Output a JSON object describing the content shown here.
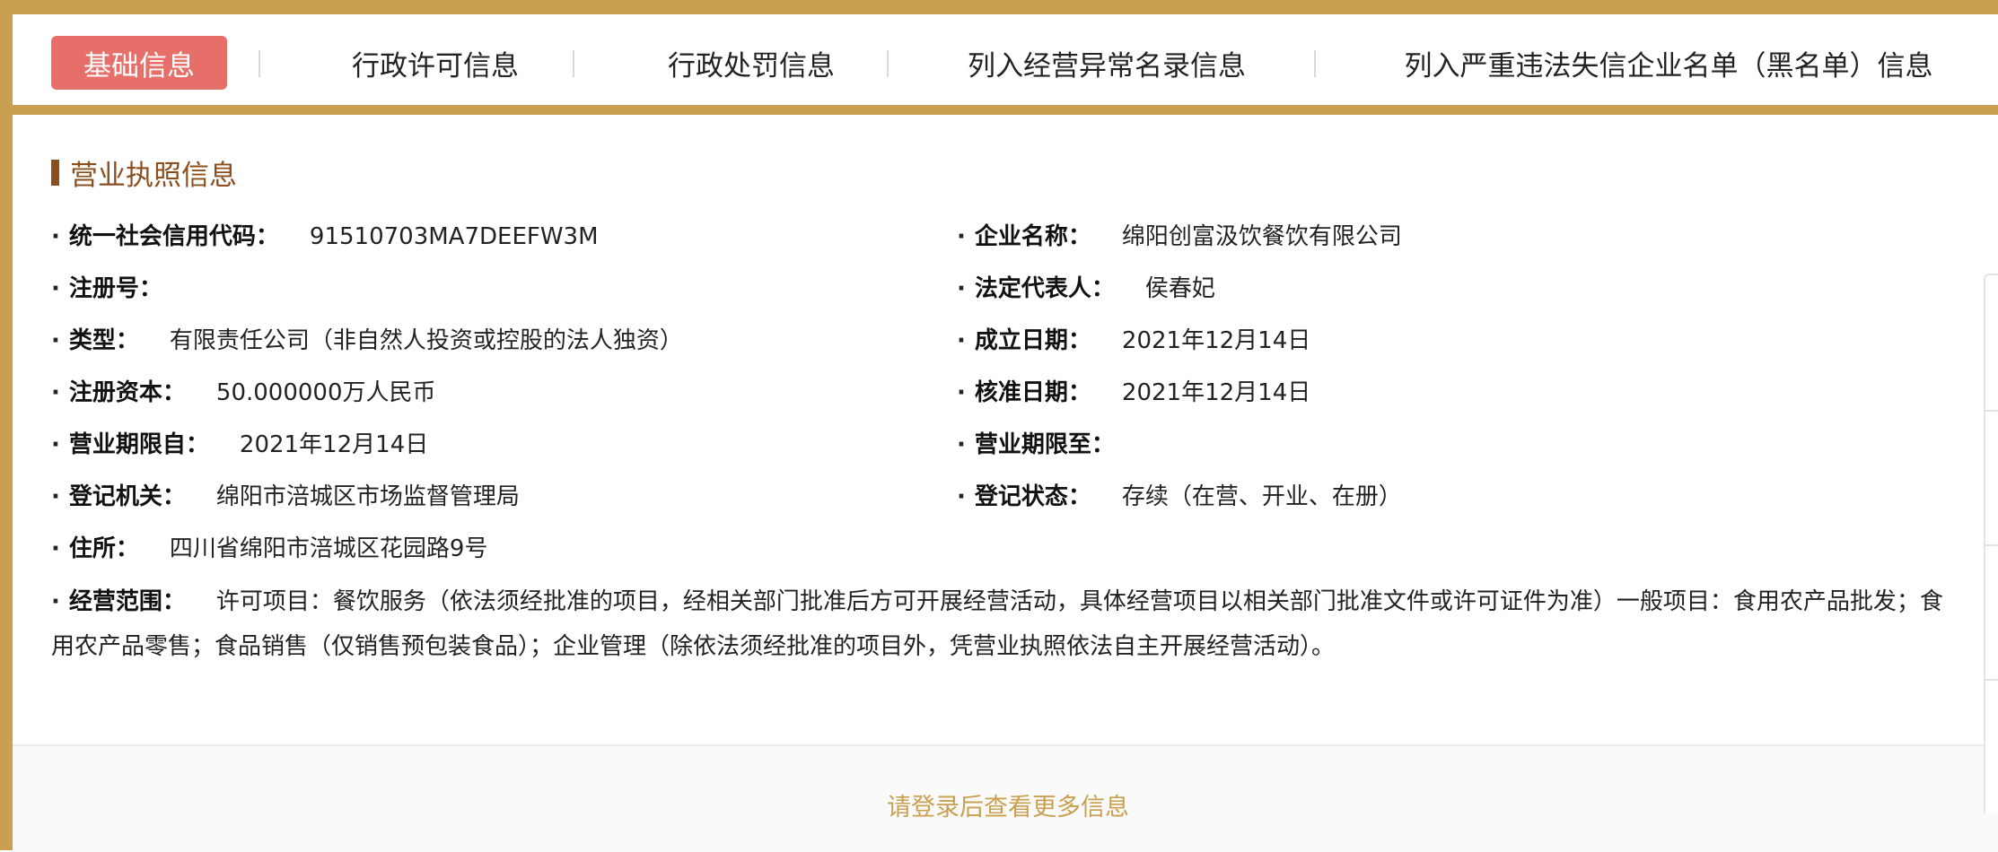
{
  "tabs": [
    {
      "label": "基础信息",
      "active": true
    },
    {
      "label": "行政许可信息",
      "active": false
    },
    {
      "label": "行政处罚信息",
      "active": false
    },
    {
      "label": "列入经营异常名录信息",
      "active": false
    },
    {
      "label": "列入严重违法失信企业名单（黑名单）信息",
      "active": false
    }
  ],
  "section_title": "营业执照信息",
  "bullet": "·",
  "fields": {
    "credit_code": {
      "label": "统一社会信用代码：",
      "value": "91510703MA7DEEFW3M"
    },
    "company_name": {
      "label": "企业名称：",
      "value": "绵阳创富汲饮餐饮有限公司"
    },
    "reg_no": {
      "label": "注册号：",
      "value": ""
    },
    "legal_rep": {
      "label": "法定代表人：",
      "value": "侯春妃"
    },
    "type": {
      "label": "类型：",
      "value": "有限责任公司（非自然人投资或控股的法人独资）"
    },
    "established": {
      "label": "成立日期：",
      "value": "2021年12月14日"
    },
    "capital": {
      "label": "注册资本：",
      "value": "50.000000万人民币"
    },
    "approved": {
      "label": "核准日期：",
      "value": "2021年12月14日"
    },
    "term_from": {
      "label": "营业期限自：",
      "value": "2021年12月14日"
    },
    "term_to": {
      "label": "营业期限至：",
      "value": ""
    },
    "authority": {
      "label": "登记机关：",
      "value": "绵阳市涪城区市场监督管理局"
    },
    "status": {
      "label": "登记状态：",
      "value": "存续（在营、开业、在册）"
    },
    "address": {
      "label": "住所：",
      "value": "四川省绵阳市涪城区花园路9号"
    }
  },
  "scope": {
    "label": "经营范围：",
    "value": "许可项目：餐饮服务（依法须经批准的项目，经相关部门批准后方可开展经营活动，具体经营项目以相关部门批准文件或许可证件为准）一般项目：食用农产品批发；食用农产品零售；食品销售（仅销售预包装食品）；企业管理（除依法须经批准的项目外，凭营业执照依法自主开展经营活动）。"
  },
  "footer": {
    "login_prompt": "请登录后查看更多信息"
  },
  "colors": {
    "gold": "#c9a04f",
    "active_tab": "#e66f6a",
    "section": "#8a4f1e"
  }
}
